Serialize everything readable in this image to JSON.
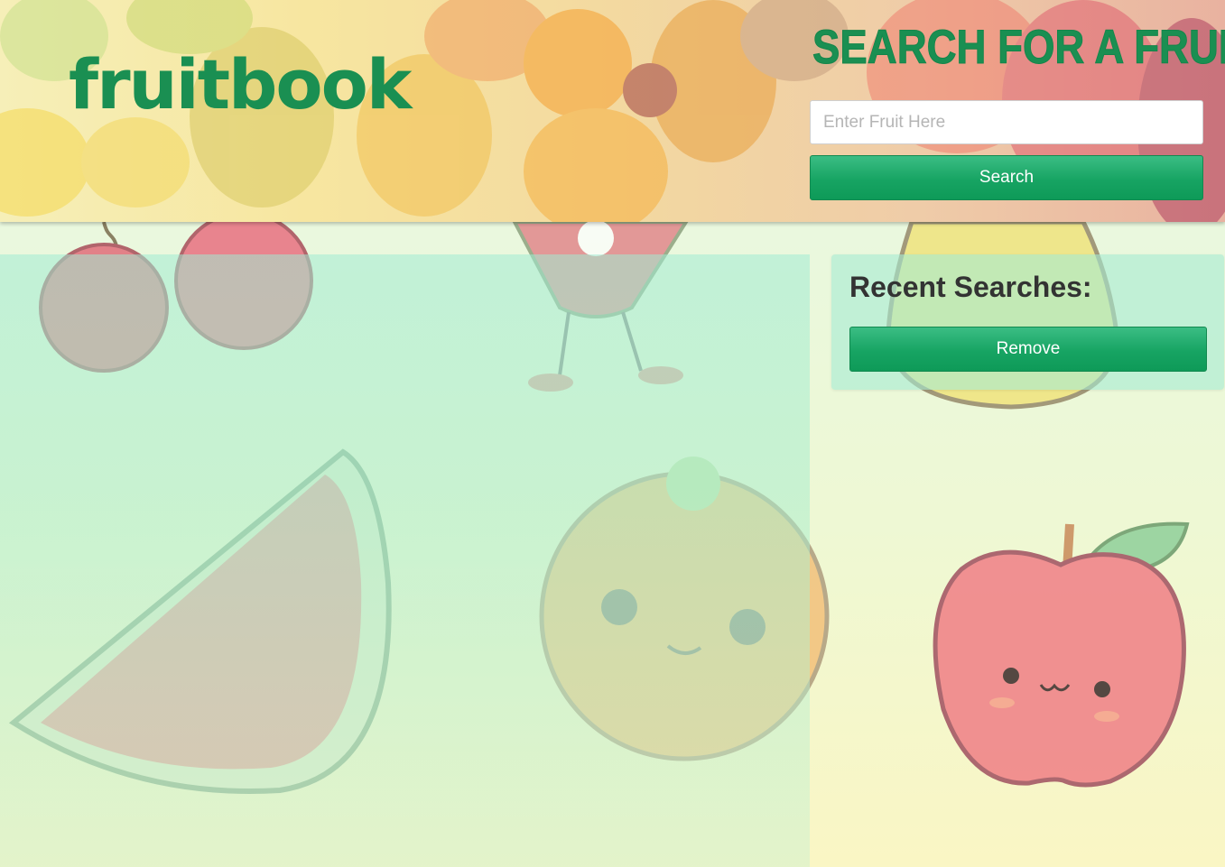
{
  "header": {
    "logo": "fruitbook",
    "search_title": "SEARCH FOR A FRUIT",
    "search_placeholder": "Enter Fruit Here",
    "search_value": "",
    "search_button": "Search"
  },
  "sidebar": {
    "title": "Recent Searches:",
    "remove_button": "Remove",
    "items": []
  },
  "main": {
    "results": []
  },
  "colors": {
    "brand_green": "#1a8f52",
    "button_green": "#17a463",
    "panel_mint": "#a5ebd2"
  }
}
